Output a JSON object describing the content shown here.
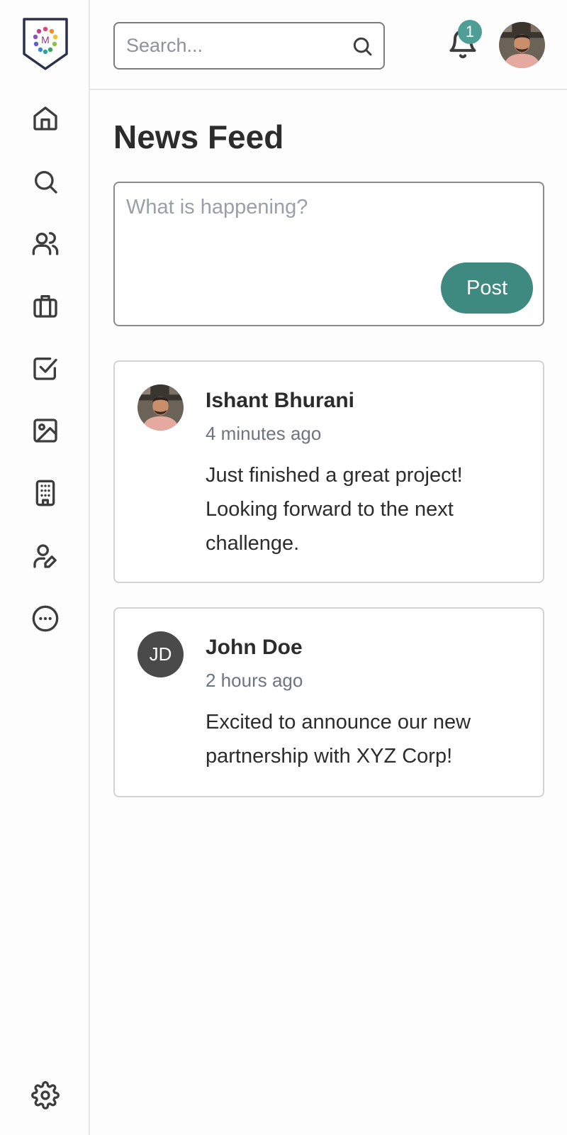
{
  "app": {
    "brand_letter": "M"
  },
  "sidebar": {
    "items": [
      {
        "name": "home",
        "icon": "home-icon"
      },
      {
        "name": "search",
        "icon": "search-icon"
      },
      {
        "name": "people",
        "icon": "users-icon"
      },
      {
        "name": "jobs",
        "icon": "briefcase-icon"
      },
      {
        "name": "tasks",
        "icon": "checkbox-icon"
      },
      {
        "name": "media",
        "icon": "image-icon"
      },
      {
        "name": "companies",
        "icon": "building-icon"
      },
      {
        "name": "profile-edit",
        "icon": "user-edit-icon"
      },
      {
        "name": "more",
        "icon": "more-icon"
      }
    ],
    "settings_icon": "gear-icon"
  },
  "header": {
    "search_placeholder": "Search...",
    "notification_count": "1",
    "accent_color": "#4f9e95"
  },
  "main": {
    "title": "News Feed",
    "composer": {
      "placeholder": "What is happening?",
      "post_label": "Post"
    },
    "posts": [
      {
        "author": "Ishant Bhurani",
        "time": "4 minutes ago",
        "content": "Just finished a great project! Looking forward to the next challenge.",
        "avatar": "photo"
      },
      {
        "author": "John Doe",
        "time": "2 hours ago",
        "content": "Excited to announce our new partnership with XYZ Corp!",
        "avatar_initials": "JD"
      }
    ]
  },
  "colors": {
    "primary_button": "#3f8a80",
    "badge": "#4f9e95"
  }
}
